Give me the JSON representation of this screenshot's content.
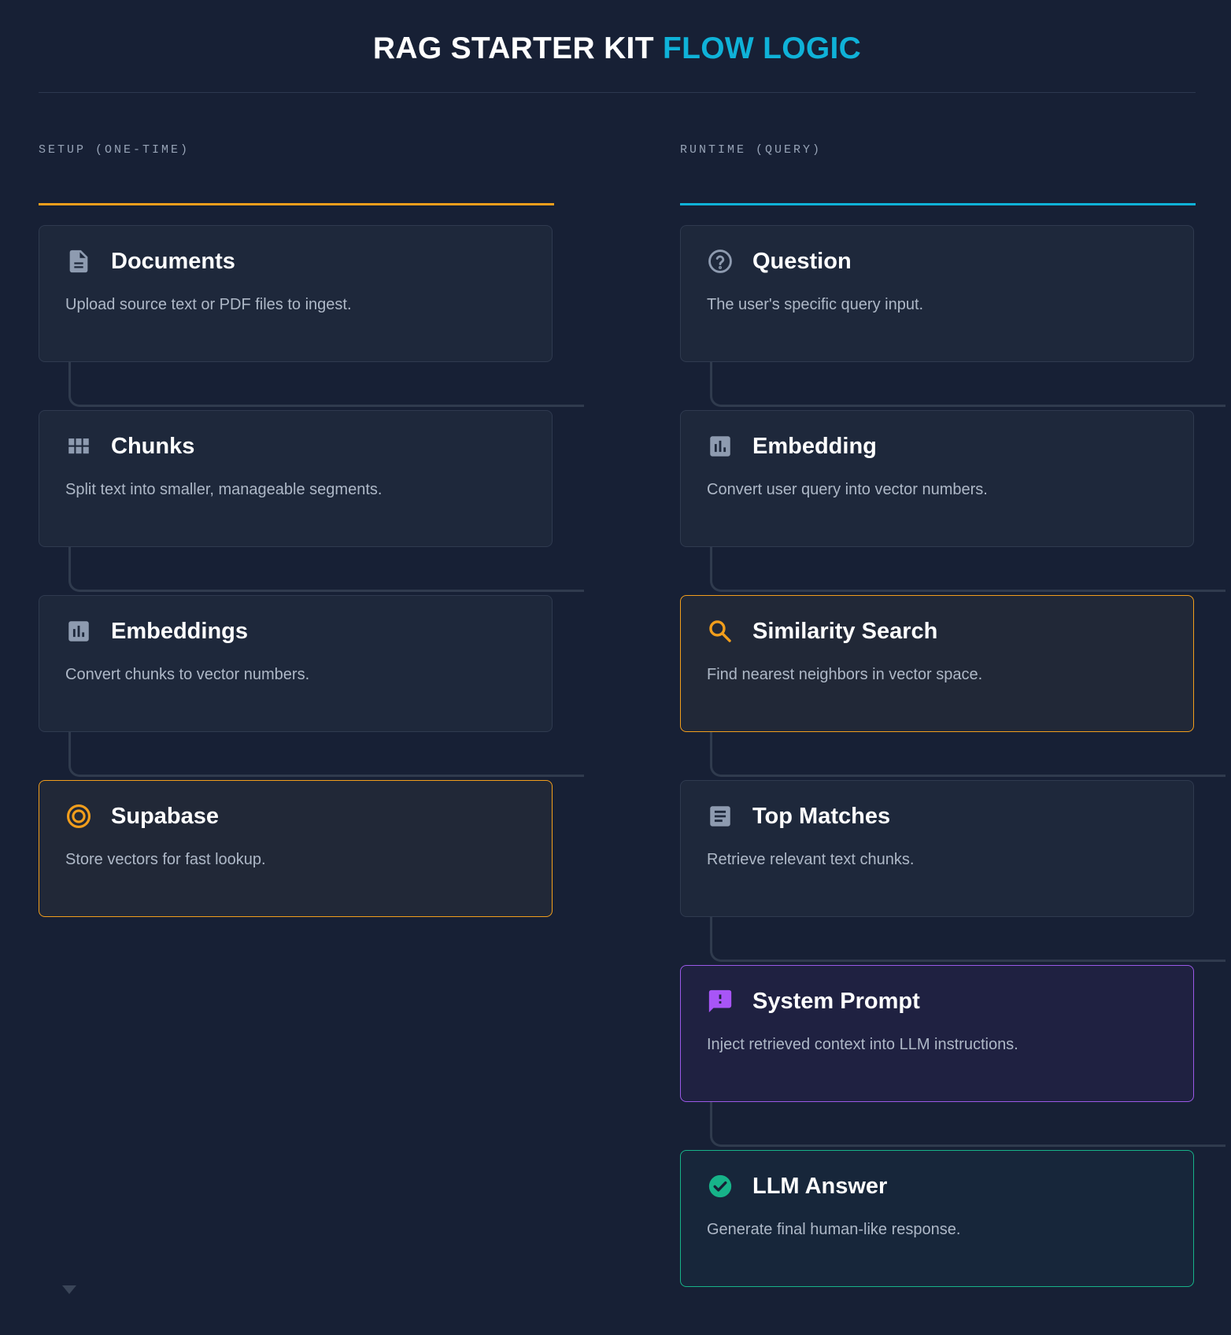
{
  "header": {
    "title_main": "RAG STARTER KIT",
    "title_accent": "FLOW LOGIC"
  },
  "colors": {
    "background": "#172035",
    "accent_cyan": "#0fb2d8",
    "accent_orange": "#f29e1c",
    "accent_purple": "#9b59e8",
    "accent_green": "#17b389",
    "icon_gray": "#8e9bb0"
  },
  "setup": {
    "heading": "SETUP (ONE-TIME)",
    "rule_color": "#f29e1c",
    "steps": [
      {
        "title": "Documents",
        "description": "Upload source text or PDF files to ingest.",
        "icon": "document-icon"
      },
      {
        "title": "Chunks",
        "description": "Split text into smaller, manageable segments.",
        "icon": "grid-icon"
      },
      {
        "title": "Embeddings",
        "description": "Convert chunks to vector numbers.",
        "icon": "bar-chart-icon"
      },
      {
        "title": "Supabase",
        "description": "Store vectors for fast lookup.",
        "icon": "target-icon",
        "highlight": "orange"
      }
    ]
  },
  "runtime": {
    "heading": "RUNTIME (QUERY)",
    "rule_color": "#0fb2d8",
    "steps": [
      {
        "title": "Question",
        "description": "The user's specific query input.",
        "icon": "help-circle-icon"
      },
      {
        "title": "Embedding",
        "description": "Convert user query into vector numbers.",
        "icon": "bar-chart-icon"
      },
      {
        "title": "Similarity Search",
        "description": "Find nearest neighbors in vector space.",
        "icon": "search-icon",
        "highlight": "orange"
      },
      {
        "title": "Top Matches",
        "description": "Retrieve relevant text chunks.",
        "icon": "article-icon"
      },
      {
        "title": "System Prompt",
        "description": "Inject retrieved context into LLM instructions.",
        "icon": "chat-alert-icon",
        "highlight": "purple"
      },
      {
        "title": "LLM Answer",
        "description": "Generate final human-like response.",
        "icon": "check-circle-icon",
        "highlight": "green"
      }
    ]
  }
}
